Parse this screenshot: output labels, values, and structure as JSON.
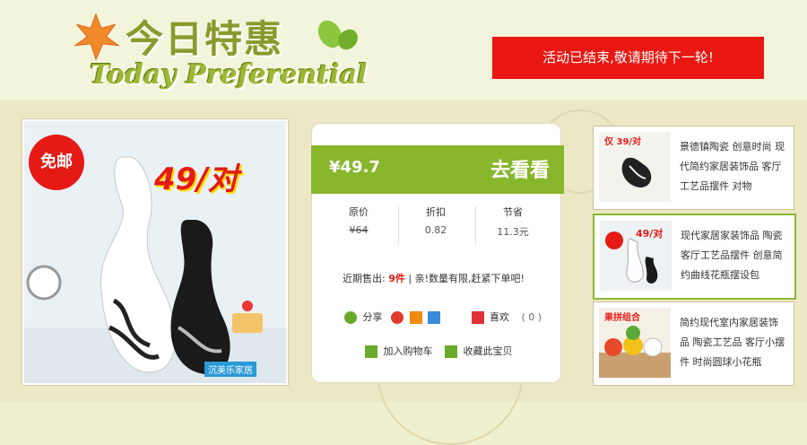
{
  "header": {
    "title_zh": "今日特惠",
    "title_en": "Today Preferential",
    "notice": "活动已结束,敬请期待下一轮!"
  },
  "product": {
    "badge": "免邮",
    "promo": "49/对",
    "price": "¥49.7",
    "cta": "去看看",
    "stats": [
      {
        "label": "原价",
        "value": "¥64"
      },
      {
        "label": "折扣",
        "value": "0.82"
      },
      {
        "label": "节省",
        "value": "11.3元"
      }
    ],
    "sold_prefix": "近期售出:",
    "sold_count": "9件",
    "sold_suffix": "| 亲!数量有限,赶紧下单吧!",
    "share_label": "分享",
    "like_label": "喜欢",
    "like_count": "( 0 )",
    "add_cart": "加入购物车",
    "collect": "收藏此宝贝",
    "watermark": "沉美乐家居"
  },
  "sidebar": {
    "items": [
      {
        "text": "景德镇陶瓷 创意时尚 现代简约家居装饰品 客厅工艺品摆件 对物",
        "badge": "仅 39/对"
      },
      {
        "text": "现代家居家装饰品 陶瓷客厅工艺品摆件 创意简约曲线花瓶摆设包",
        "badge": "49/对"
      },
      {
        "text": "简约现代室内家居装饰品 陶瓷工艺品 客厅小摆件 时尚圆球小花瓶",
        "badge": "果拼组合"
      }
    ]
  },
  "colors": {
    "accent": "#88b62c",
    "notice": "#e81712",
    "bg": "#ece7c5"
  }
}
